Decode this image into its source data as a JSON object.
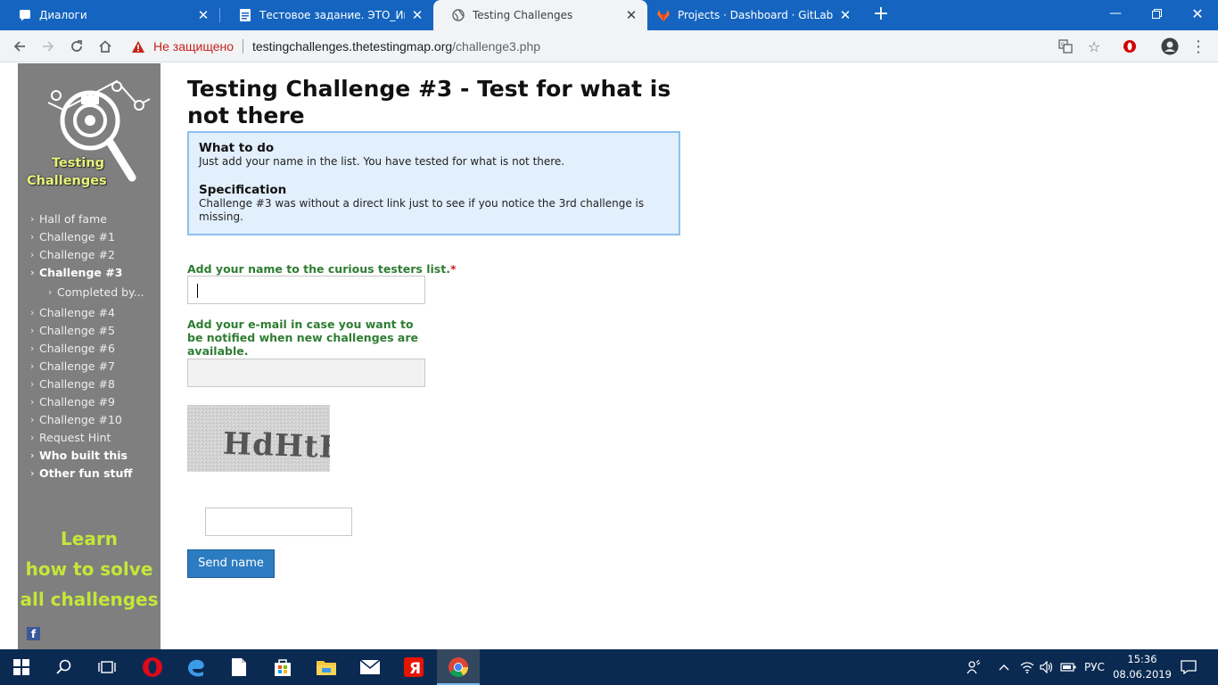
{
  "browser": {
    "tabs": [
      {
        "title": "Диалоги",
        "icon": "vk-icon",
        "active": false
      },
      {
        "title": "Тестовое задание. ЭТО_Инкубатор",
        "icon": "docs-icon",
        "active": false
      },
      {
        "title": "Testing Challenges",
        "icon": "globe-icon",
        "active": true
      },
      {
        "title": "Projects · Dashboard · GitLab",
        "icon": "gitlab-icon",
        "active": false
      }
    ],
    "address": {
      "security_label": "Не защищено",
      "host": "testingchallenges.thetestingmap.org",
      "path": "/challenge3.php"
    }
  },
  "sidebar": {
    "logo_line1": "Testing",
    "logo_line2": "Challenges",
    "items": [
      {
        "label": "Hall of fame"
      },
      {
        "label": "Challenge #1"
      },
      {
        "label": "Challenge #2"
      },
      {
        "label": "Challenge #3"
      },
      {
        "label": "Completed by..."
      },
      {
        "label": "Challenge #4"
      },
      {
        "label": "Challenge #5"
      },
      {
        "label": "Challenge #6"
      },
      {
        "label": "Challenge #7"
      },
      {
        "label": "Challenge #8"
      },
      {
        "label": "Challenge #9"
      },
      {
        "label": "Challenge #10"
      },
      {
        "label": "Request Hint"
      },
      {
        "label": "Who built this"
      },
      {
        "label": "Other fun stuff"
      }
    ],
    "learn_lines": [
      "Learn",
      "how to solve",
      "all challenges"
    ],
    "facebook": "f"
  },
  "main": {
    "title": "Testing Challenge #3 - Test for what is not there",
    "what_heading": "What to do",
    "what_text": "Just add your name in the list. You have tested for what is not there.",
    "spec_heading": "Specification",
    "spec_text": "Challenge #3 was without a direct link just to see if you notice the 3rd challenge is missing.",
    "name_label": "Add your name to the curious testers list.",
    "required_mark": "*",
    "name_value": "",
    "email_label": "Add your e-mail in case you want to be notified when new challenges are available.",
    "email_value": "",
    "captcha_text": "HdHtE",
    "captcha_value": "",
    "send_button": "Send name"
  },
  "taskbar": {
    "language": "РУС",
    "time": "15:36",
    "date": "08.06.2019"
  }
}
